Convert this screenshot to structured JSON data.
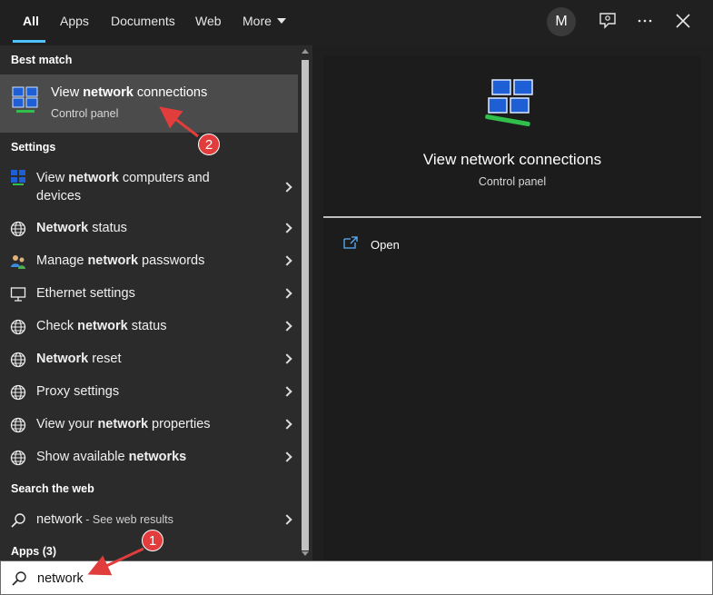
{
  "tabs": [
    {
      "label": "All"
    },
    {
      "label": "Apps"
    },
    {
      "label": "Documents"
    },
    {
      "label": "Web"
    },
    {
      "label": "More"
    }
  ],
  "top_right": {
    "avatar_letter": "M",
    "icons": [
      "feedback-icon",
      "more-options-icon",
      "close-icon"
    ]
  },
  "sections": {
    "best_match": "Best match",
    "settings": "Settings",
    "search_web": "Search the web",
    "apps": "Apps (3)"
  },
  "best_match": {
    "title_pre": "View ",
    "title_bold": "network",
    "title_post": " connections",
    "subtitle": "Control panel"
  },
  "settings_items": [
    {
      "pre": "View ",
      "bold": "network",
      "post": " computers and",
      "line2": "devices",
      "icon": "network-computers-icon"
    },
    {
      "pre": "",
      "bold": "Network",
      "post": " status",
      "icon": "globe-icon"
    },
    {
      "pre": "Manage ",
      "bold": "network",
      "post": " passwords",
      "icon": "users-icon"
    },
    {
      "pre": "Ethernet settings",
      "bold": "",
      "post": "",
      "icon": "ethernet-icon"
    },
    {
      "pre": "Check ",
      "bold": "network",
      "post": " status",
      "icon": "globe-icon"
    },
    {
      "pre": "",
      "bold": "Network",
      "post": " reset",
      "icon": "globe-icon"
    },
    {
      "pre": "Proxy settings",
      "bold": "",
      "post": "",
      "icon": "globe-icon"
    },
    {
      "pre": "View your ",
      "bold": "network",
      "post": " properties",
      "icon": "globe-icon"
    },
    {
      "pre": "Show available ",
      "bold": "networks",
      "post": "",
      "icon": "globe-icon"
    }
  ],
  "web_result": {
    "query": "network",
    "suffix": " - See web results"
  },
  "preview": {
    "title": "View network connections",
    "subtitle": "Control panel",
    "action": "Open"
  },
  "search": {
    "value": "network"
  },
  "annotations": [
    {
      "label": "1"
    },
    {
      "label": "2"
    }
  ],
  "colors": {
    "accent": "#4cc2ff",
    "annotation": "#e23d3d"
  }
}
